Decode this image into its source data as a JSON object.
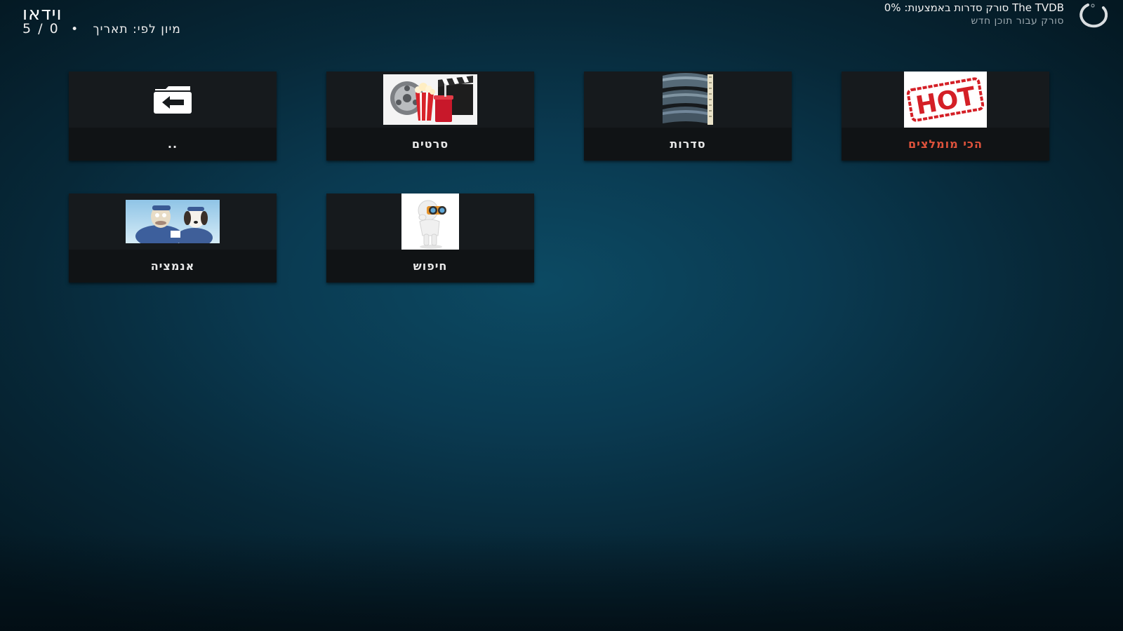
{
  "header": {
    "title": "וידאו",
    "sort_label": "מיון לפי: תאריך",
    "separator": "•",
    "item_count": "5 / 0"
  },
  "status": {
    "line1": "0%  :סורק סדרות באמצעות The TVDB",
    "line2": "סורק עבור תוכן חדש"
  },
  "tiles": [
    {
      "label": "..",
      "icon": "folder-back-icon"
    },
    {
      "label": "סרטים",
      "icon": "movies-popcorn-thumbnail"
    },
    {
      "label": "סדרות",
      "icon": "tv-series-stack-thumbnail"
    },
    {
      "label": "הכי מומלצים",
      "icon": "hot-stamp-thumbnail"
    },
    {
      "label": "אנמציה",
      "icon": "animation-characters-thumbnail"
    },
    {
      "label": "חיפוש",
      "icon": "binoculars-figure-thumbnail"
    }
  ],
  "colors": {
    "focus_label": "#e0533c",
    "tile_background": "#161a1d",
    "background": "#0a3a51"
  }
}
